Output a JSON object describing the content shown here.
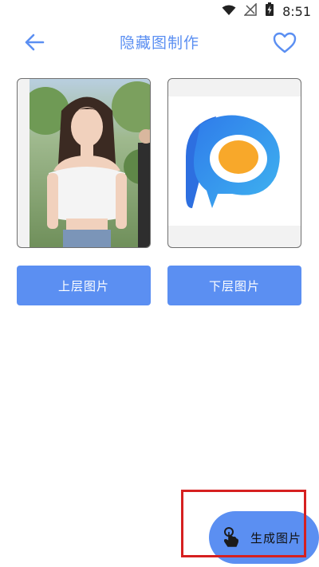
{
  "status_bar": {
    "time": "8:51",
    "icons": [
      "wifi-icon",
      "no-signal-icon",
      "battery-charging-icon"
    ]
  },
  "header": {
    "title": "隐藏图制作",
    "back_icon": "arrow-left-icon",
    "favorite_icon": "heart-outline-icon"
  },
  "images": {
    "top_layer_description": "photo",
    "bottom_layer_description": "logo"
  },
  "buttons": {
    "top_layer_label": "上层图片",
    "bottom_layer_label": "下层图片"
  },
  "fab": {
    "label": "生成图片",
    "icon": "hand-tap-icon"
  },
  "colors": {
    "accent": "#5b8ff2",
    "highlight": "#d62020"
  }
}
